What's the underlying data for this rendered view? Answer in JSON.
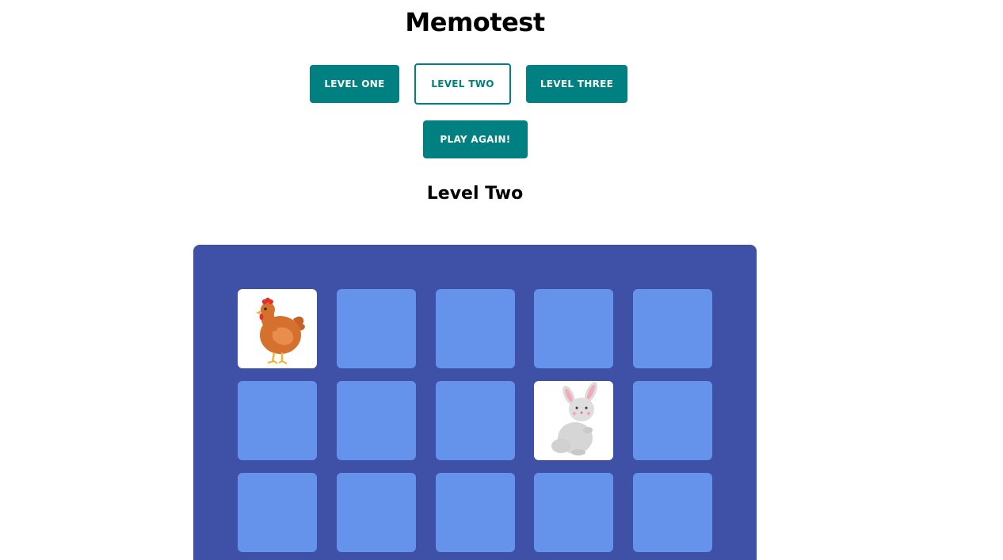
{
  "header": {
    "title": "Memotest"
  },
  "levels": {
    "level_one_label": "LEVEL ONE",
    "level_two_label": "LEVEL TWO",
    "level_three_label": "LEVEL THREE",
    "selected": "LEVEL TWO"
  },
  "actions": {
    "play_again_label": "PLAY AGAIN!"
  },
  "game": {
    "level_title": "Level Two",
    "columns": 5,
    "visible_rows": 3,
    "cards": [
      {
        "row": 1,
        "col": 1,
        "state": "revealed",
        "image": "chicken-icon"
      },
      {
        "row": 1,
        "col": 2,
        "state": "hidden"
      },
      {
        "row": 1,
        "col": 3,
        "state": "hidden"
      },
      {
        "row": 1,
        "col": 4,
        "state": "hidden"
      },
      {
        "row": 1,
        "col": 5,
        "state": "hidden"
      },
      {
        "row": 2,
        "col": 1,
        "state": "hidden"
      },
      {
        "row": 2,
        "col": 2,
        "state": "hidden"
      },
      {
        "row": 2,
        "col": 3,
        "state": "hidden"
      },
      {
        "row": 2,
        "col": 4,
        "state": "revealed",
        "image": "rabbit-icon"
      },
      {
        "row": 2,
        "col": 5,
        "state": "hidden"
      },
      {
        "row": 3,
        "col": 1,
        "state": "hidden"
      },
      {
        "row": 3,
        "col": 2,
        "state": "hidden"
      },
      {
        "row": 3,
        "col": 3,
        "state": "hidden"
      },
      {
        "row": 3,
        "col": 4,
        "state": "hidden"
      },
      {
        "row": 3,
        "col": 5,
        "state": "hidden"
      }
    ]
  },
  "colors": {
    "button_teal": "#008080",
    "board_background": "#3e51a6",
    "card_back": "#6593eb",
    "card_face": "#ffffff"
  }
}
